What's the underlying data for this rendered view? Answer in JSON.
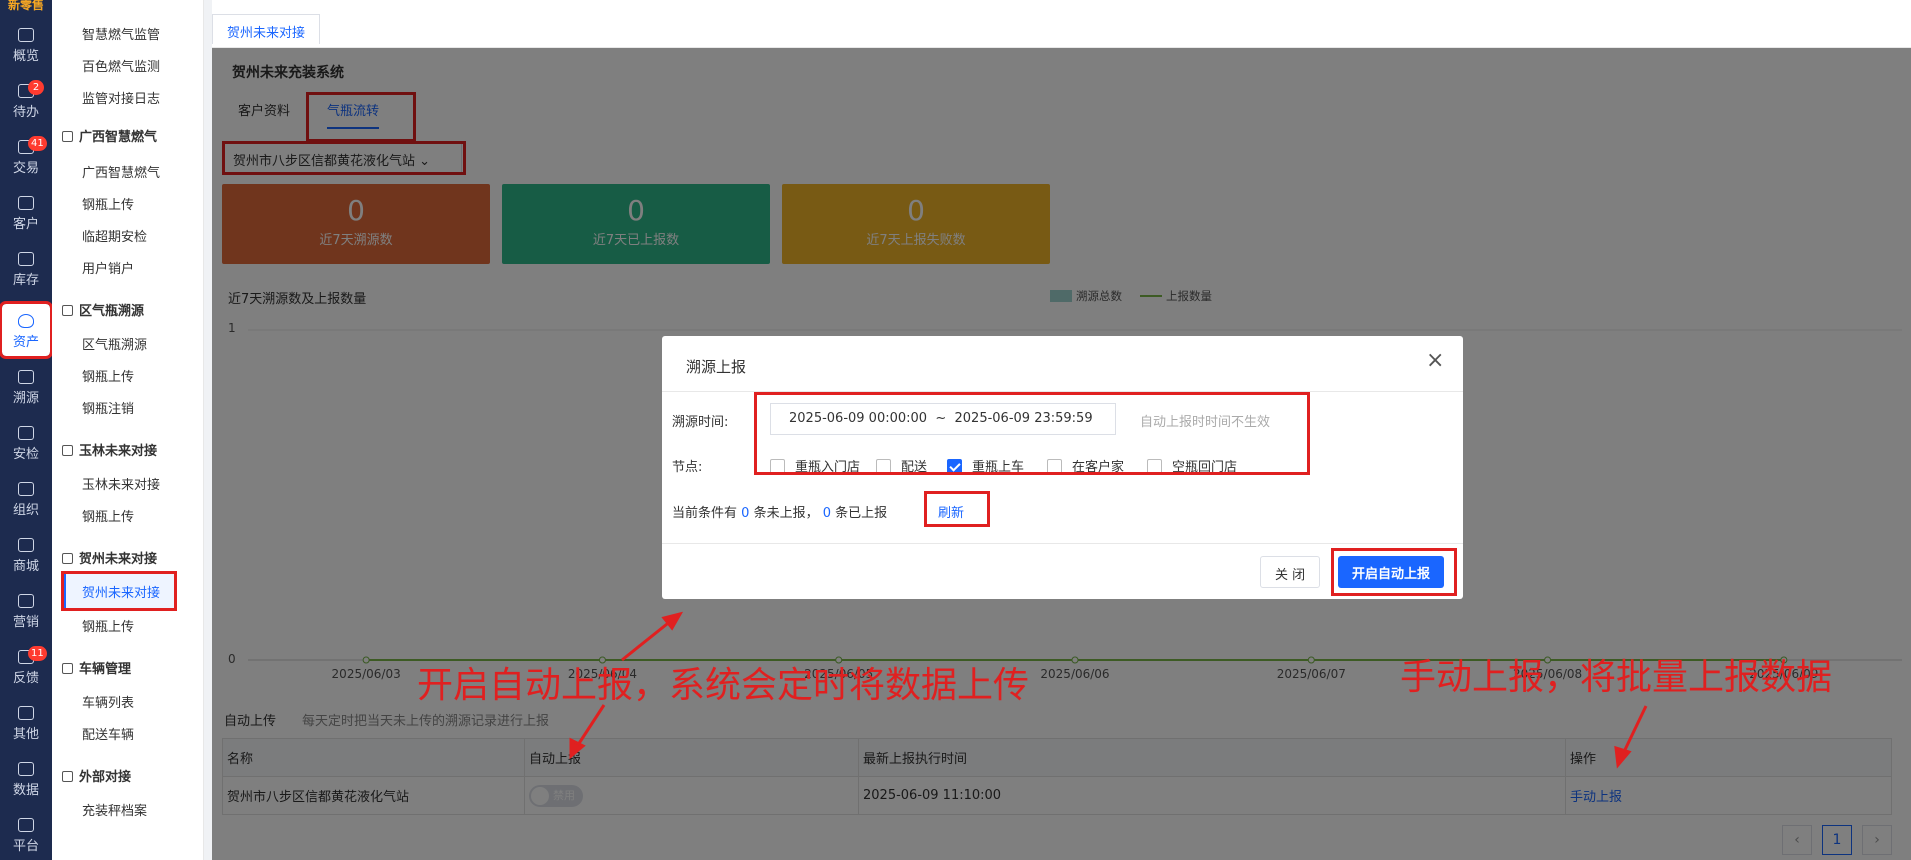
{
  "rail": {
    "brand": "新零售",
    "items": [
      {
        "label": "概览",
        "icon": "trend-chart-icon",
        "badge": ""
      },
      {
        "label": "待办",
        "icon": "clipboard-icon",
        "badge": "2"
      },
      {
        "label": "交易",
        "icon": "bag-icon",
        "badge": "41"
      },
      {
        "label": "客户",
        "icon": "id-card-icon",
        "badge": ""
      },
      {
        "label": "库存",
        "icon": "box-icon",
        "badge": ""
      },
      {
        "label": "资产",
        "icon": "bulb-icon",
        "badge": ""
      },
      {
        "label": "溯源",
        "icon": "compass-icon",
        "badge": ""
      },
      {
        "label": "安检",
        "icon": "shield-check-icon",
        "badge": ""
      },
      {
        "label": "组织",
        "icon": "org-tree-icon",
        "badge": ""
      },
      {
        "label": "商城",
        "icon": "store-icon",
        "badge": ""
      },
      {
        "label": "营销",
        "icon": "trophy-icon",
        "badge": ""
      },
      {
        "label": "反馈",
        "icon": "feedback-icon",
        "badge": "11"
      },
      {
        "label": "其他",
        "icon": "apps-icon",
        "badge": ""
      },
      {
        "label": "数据",
        "icon": "data-chart-icon",
        "badge": ""
      },
      {
        "label": "平台",
        "icon": "platform-icon",
        "badge": ""
      }
    ]
  },
  "menu": {
    "top_items": [
      "智慧燃气监管",
      "百色燃气监测",
      "监管对接日志"
    ],
    "groups": [
      {
        "title": "广西智慧燃气",
        "items": [
          "广西智慧燃气",
          "钢瓶上传",
          "临超期安检",
          "用户销户"
        ]
      },
      {
        "title": "区气瓶溯源",
        "items": [
          "区气瓶溯源",
          "钢瓶上传",
          "钢瓶注销"
        ]
      },
      {
        "title": "玉林未来对接",
        "items": [
          "玉林未来对接",
          "钢瓶上传"
        ]
      },
      {
        "title": "贺州未来对接",
        "items": [
          "贺州未来对接",
          "钢瓶上传"
        ]
      },
      {
        "title": "车辆管理",
        "items": [
          "车辆列表",
          "配送车辆"
        ]
      },
      {
        "title": "外部对接",
        "items": [
          "充装秤档案"
        ]
      }
    ]
  },
  "tabbar": {
    "active_tab": "贺州未来对接"
  },
  "page": {
    "system_title": "贺州未来充装系统",
    "subtabs": [
      "客户资料",
      "气瓶流转"
    ],
    "station": "贺州市八步区信都黄花液化气站",
    "cards": [
      {
        "value": "0",
        "label": "近7天溯源数",
        "color": "#e06a3b"
      },
      {
        "value": "0",
        "label": "近7天已上报数",
        "color": "#2fb98a"
      },
      {
        "value": "0",
        "label": "近7天上报失败数",
        "color": "#f0b429"
      }
    ]
  },
  "chart_data": {
    "type": "line",
    "title": "近7天溯源数及上报数量",
    "x": [
      "2025/06/03",
      "2025/06/04",
      "2025/06/05",
      "2025/06/06",
      "2025/06/07",
      "2025/06/08",
      "2025/06/09"
    ],
    "series": [
      {
        "name": "溯源总数",
        "values": [
          0,
          0,
          0,
          0,
          0,
          0,
          0
        ],
        "color": "#9fd4d0"
      },
      {
        "name": "上报数量",
        "values": [
          0,
          0,
          0,
          0,
          0,
          0,
          0
        ],
        "color": "#7ab648"
      }
    ],
    "yticks": [
      "1",
      "0"
    ],
    "ylim": [
      0,
      1
    ],
    "legend": "top-right"
  },
  "auto_upload": {
    "label": "自动上传",
    "desc": "每天定时把当天未上传的溯源记录进行上报",
    "columns": [
      "名称",
      "自动上报",
      "最新上报执行时间",
      "操作"
    ],
    "row": {
      "name": "贺州市八步区信都黄花液化气站",
      "toggle": "禁用",
      "time": "2025-06-09 11:10:00",
      "action": "手动上报"
    },
    "page": "1"
  },
  "dialog": {
    "title": "溯源上报",
    "close": "×",
    "time_label": "溯源时间:",
    "time_start": "2025-06-09 00:00:00",
    "time_sep": "~",
    "time_end": "2025-06-09 23:59:59",
    "time_hint": "自动上报时时间不生效",
    "node_label": "节点:",
    "nodes": [
      {
        "label": "重瓶入门店",
        "checked": false
      },
      {
        "label": "配送",
        "checked": false
      },
      {
        "label": "重瓶上车",
        "checked": true
      },
      {
        "label": "在客户家",
        "checked": false
      },
      {
        "label": "空瓶回门店",
        "checked": false
      }
    ],
    "count_prefix": "当前条件有",
    "not_uploaded": "0",
    "mid_text": "条未上报，",
    "uploaded": "0",
    "suffix_text": "条已上报",
    "refresh": "刷新",
    "btn_close": "关 闭",
    "btn_auto": "开启自动上报"
  },
  "annotations": {
    "left": "开启自动上报，系统会定时将数据上传",
    "right": "手动上报，将批量上报数据"
  }
}
